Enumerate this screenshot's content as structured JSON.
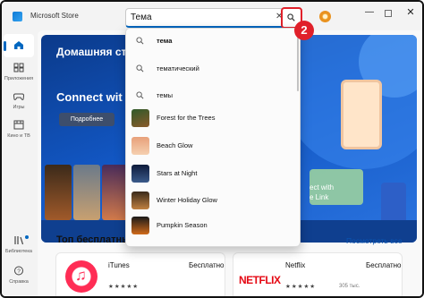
{
  "window": {
    "title": "Microsoft Store",
    "controls": {
      "minimize": "—",
      "close": "✕"
    }
  },
  "search": {
    "value": "Тема",
    "clear_glyph": "✕",
    "step_marker": "2"
  },
  "nav": {
    "items": [
      {
        "label": "",
        "icon": "home-icon"
      },
      {
        "label": "Приложения",
        "icon": "apps-icon"
      },
      {
        "label": "Игры",
        "icon": "gamepad-icon"
      },
      {
        "label": "Кино и ТВ",
        "icon": "film-icon"
      },
      {
        "label": "Библиотека",
        "icon": "library-icon"
      },
      {
        "label": "Справка",
        "icon": "help-icon"
      }
    ]
  },
  "suggestions": [
    {
      "text": "тема",
      "icon": "search-icon"
    },
    {
      "text": "тематический",
      "icon": "search-icon"
    },
    {
      "text": "темы",
      "icon": "search-icon"
    },
    {
      "text": "Forest for the Trees",
      "icon": "forest-thumb"
    },
    {
      "text": "Beach Glow",
      "icon": "beach-thumb"
    },
    {
      "text": "Stars at Night",
      "icon": "stars-thumb"
    },
    {
      "text": "Winter Holiday Glow",
      "icon": "winter-thumb"
    },
    {
      "text": "Pumpkin Season",
      "icon": "pumpkin-thumb"
    }
  ],
  "hero": {
    "title": "Домашняя ст",
    "subtitle": "Connect wit",
    "button": "Подробнее",
    "caption": "ect with\ne Link"
  },
  "section": {
    "title": "Топ бесплатных",
    "see_all": "Посмотреть все"
  },
  "apps": [
    {
      "name": "iTunes",
      "price": "Бесплатно",
      "stars": "★★★★★",
      "rating": ""
    },
    {
      "name": "Netflix",
      "price": "Бесплатно",
      "stars": "★★★★★",
      "rating": "305 тыс.",
      "logo_text": "NETFLIX"
    }
  ],
  "colors": {
    "accent": "#0067c0",
    "highlight": "#e0202a",
    "netflix_red": "#e50914"
  }
}
